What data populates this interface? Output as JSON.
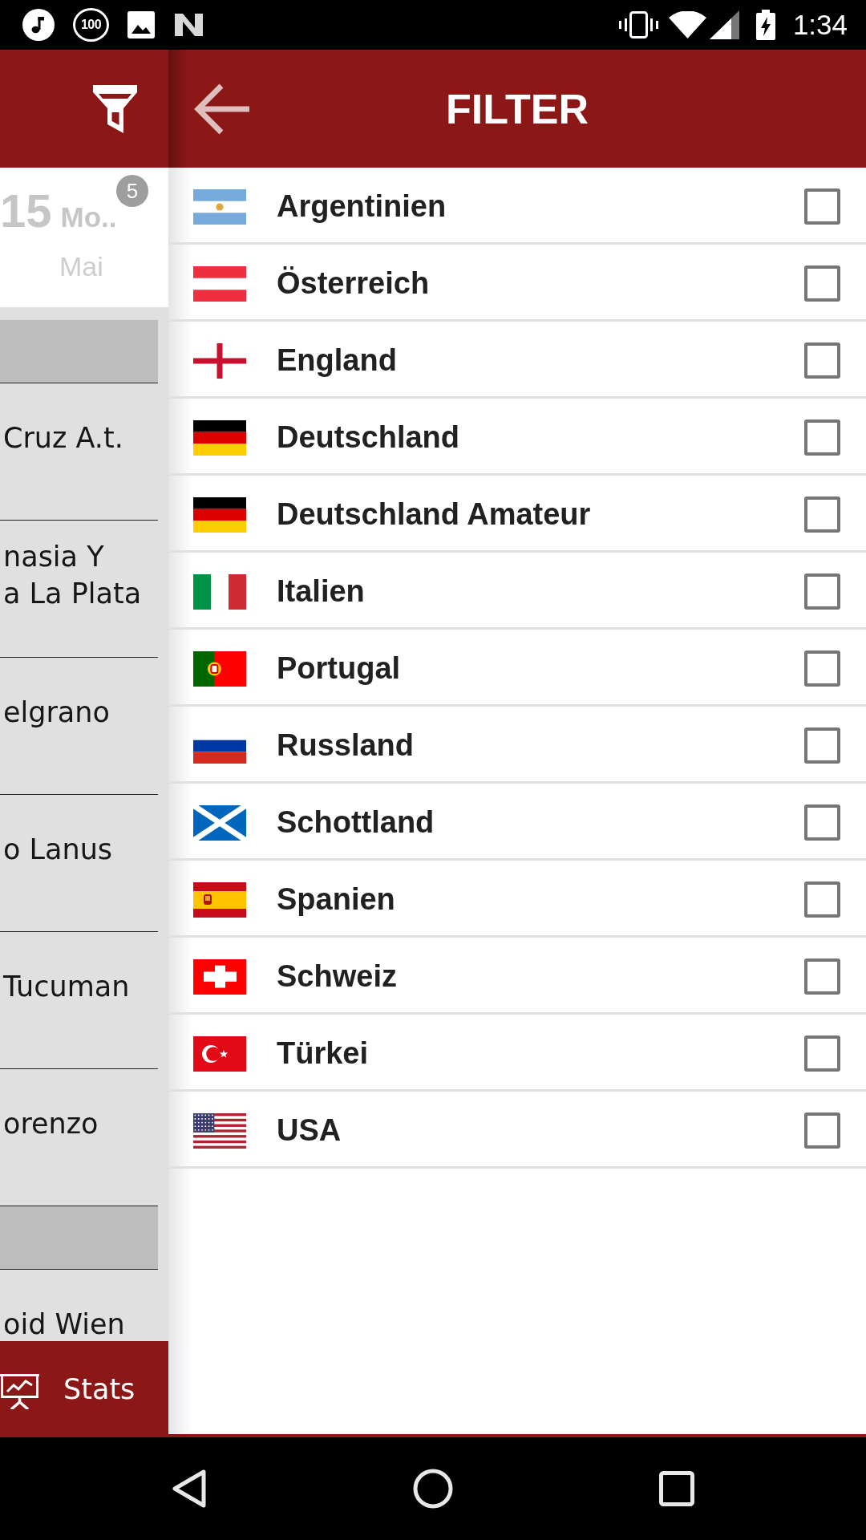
{
  "status_bar": {
    "notification_count": "100",
    "time": "1:34"
  },
  "background_screen": {
    "date_card": {
      "day": "15",
      "weekday": "Mo..",
      "month": "Mai",
      "badge": "5"
    },
    "list": [
      {
        "kind": "section"
      },
      {
        "kind": "team",
        "name": "Cruz A.t."
      },
      {
        "kind": "team",
        "name": "nasia Y\na La Plata"
      },
      {
        "kind": "team",
        "name": "elgrano"
      },
      {
        "kind": "team",
        "name": "o Lanus"
      },
      {
        "kind": "team",
        "name": "Tucuman"
      },
      {
        "kind": "team",
        "name": "orenzo"
      },
      {
        "kind": "section"
      },
      {
        "kind": "team",
        "name": "oid Wien"
      }
    ],
    "stats_button": {
      "label": "Stats"
    }
  },
  "filter_panel": {
    "title": "FILTER",
    "countries": [
      {
        "kind": "argentina",
        "name": "Argentinien",
        "checked": false
      },
      {
        "kind": "austria",
        "name": "Österreich",
        "checked": false
      },
      {
        "kind": "england",
        "name": "England",
        "checked": false
      },
      {
        "kind": "germany",
        "name": "Deutschland",
        "checked": false
      },
      {
        "kind": "germany",
        "name": "Deutschland Amateur",
        "checked": false
      },
      {
        "kind": "italy",
        "name": "Italien",
        "checked": false
      },
      {
        "kind": "portugal",
        "name": "Portugal",
        "checked": false
      },
      {
        "kind": "russia",
        "name": "Russland",
        "checked": false
      },
      {
        "kind": "scotland",
        "name": "Schottland",
        "checked": false
      },
      {
        "kind": "spain",
        "name": "Spanien",
        "checked": false
      },
      {
        "kind": "switzerland",
        "name": "Schweiz",
        "checked": false
      },
      {
        "kind": "turkey",
        "name": "Türkei",
        "checked": false
      },
      {
        "kind": "usa",
        "name": "USA",
        "checked": false
      }
    ]
  }
}
